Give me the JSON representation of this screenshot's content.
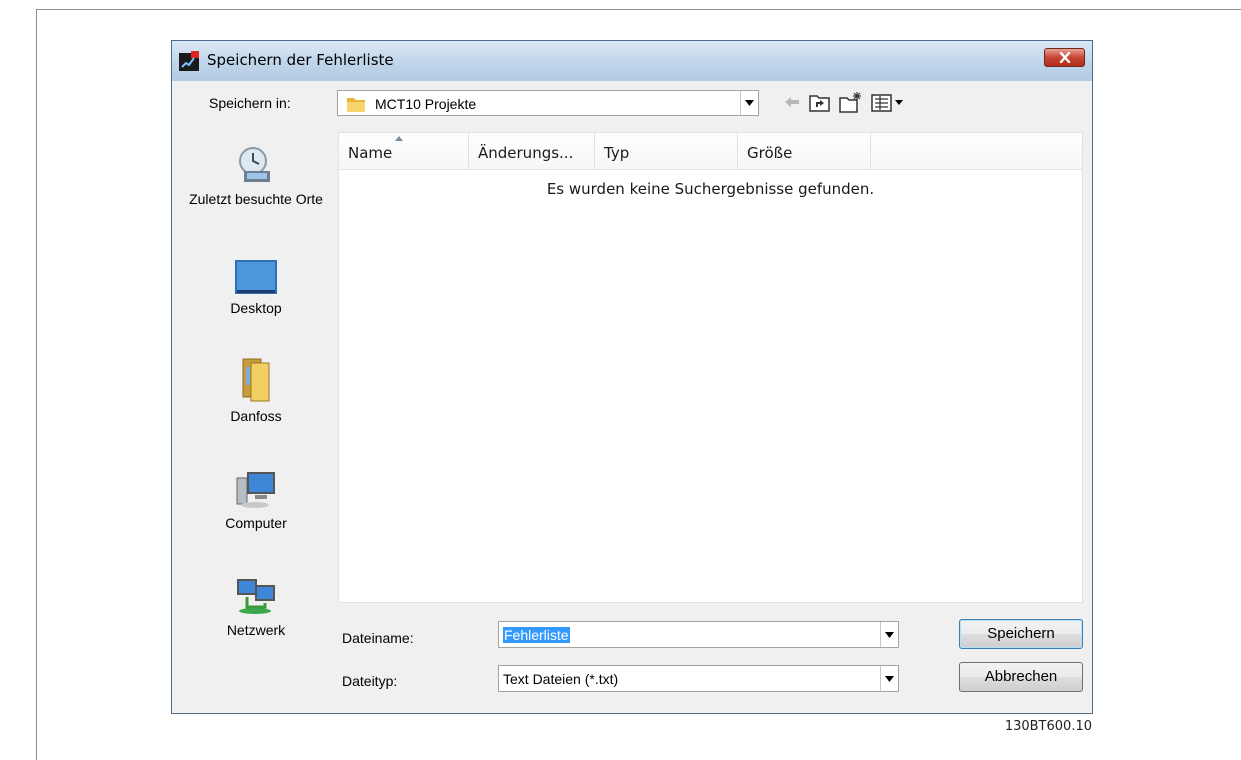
{
  "dialog": {
    "title": "Speichern der Fehlerliste",
    "save_in_label": "Speichern in:",
    "current_folder": "MCT10 Projekte"
  },
  "places": [
    {
      "label": "Zuletzt besuchte Orte",
      "icon": "recent-places-icon"
    },
    {
      "label": "Desktop",
      "icon": "desktop-icon"
    },
    {
      "label": "Danfoss",
      "icon": "folder-icon"
    },
    {
      "label": "Computer",
      "icon": "computer-icon"
    },
    {
      "label": "Netzwerk",
      "icon": "network-icon"
    }
  ],
  "file_list": {
    "columns": [
      "Name",
      "Änderungs...",
      "Typ",
      "Größe"
    ],
    "sorted_column": "Name",
    "empty_message": "Es wurden keine Suchergebnisse gefunden."
  },
  "filename": {
    "label": "Dateiname:",
    "value": "Fehlerliste"
  },
  "filetype": {
    "label": "Dateityp:",
    "value": "Text Dateien (*.txt)"
  },
  "buttons": {
    "save": "Speichern",
    "cancel": "Abbrechen"
  },
  "figure_id": "130BT600.10",
  "colors": {
    "titlebar": "#bfd5ea",
    "close": "#c74534",
    "selection": "#3399ff"
  }
}
